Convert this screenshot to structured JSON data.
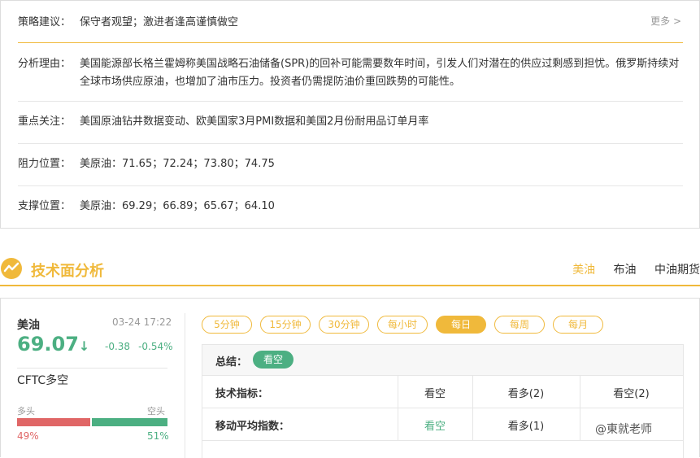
{
  "strategy": {
    "more_label": "更多 >",
    "advice_label": "策略建议：",
    "advice_value": "保守者观望；激进者逢高谨慎做空",
    "reason_label": "分析理由：",
    "reason_value": "美国能源部长格兰霍姆称美国战略石油储备(SPR)的回补可能需要数年时间，引发人们对潜在的供应过剩感到担忧。俄罗斯持续对全球市场供应原油，也增加了油市压力。投资者仍需提防油价重回跌势的可能性。",
    "focus_label": "重点关注：",
    "focus_value": "美国原油钻井数据变动、欧美国家3月PMI数据和美国2月份耐用品订单月率",
    "resist_label": "阻力位置：",
    "resist_value": "美原油：71.65；72.24；73.80；74.75",
    "support_label": "支撑位置：",
    "support_value": "美原油：69.29；66.89；65.67；64.10"
  },
  "tech": {
    "title": "技术面分析",
    "tabs": [
      "美油",
      "布油",
      "中油期货"
    ],
    "active_tab": 0
  },
  "quote": {
    "symbol": "美油",
    "time": "03-24 17:22",
    "price": "69.07",
    "arrow": "↓",
    "change": "-0.38",
    "change_pct": "-0.54%",
    "cftc_label": "CFTC多空",
    "bull_label": "多头",
    "bear_label": "空头",
    "bull_pct": "49%",
    "bear_pct": "51%",
    "bull_fraction": 0.49,
    "bear_fraction": 0.51
  },
  "periods": {
    "items": [
      "5分钟",
      "15分钟",
      "30分钟",
      "每小时",
      "每日",
      "每周",
      "每月"
    ],
    "active": 4
  },
  "table": {
    "summary_label": "总结：",
    "summary_badge": "看空",
    "rows": [
      {
        "label": "技术指标：",
        "c1": "看空",
        "c2": "看多(2)",
        "c3": "看空(2)"
      },
      {
        "label": "移动平均指数：",
        "c1": "看空",
        "c2": "看多(1)",
        "c3": ""
      }
    ]
  },
  "watermark": "@東就老师",
  "colors": {
    "accent": "#f0b93b",
    "down_green": "#4caf82",
    "bull_red": "#e06666"
  }
}
